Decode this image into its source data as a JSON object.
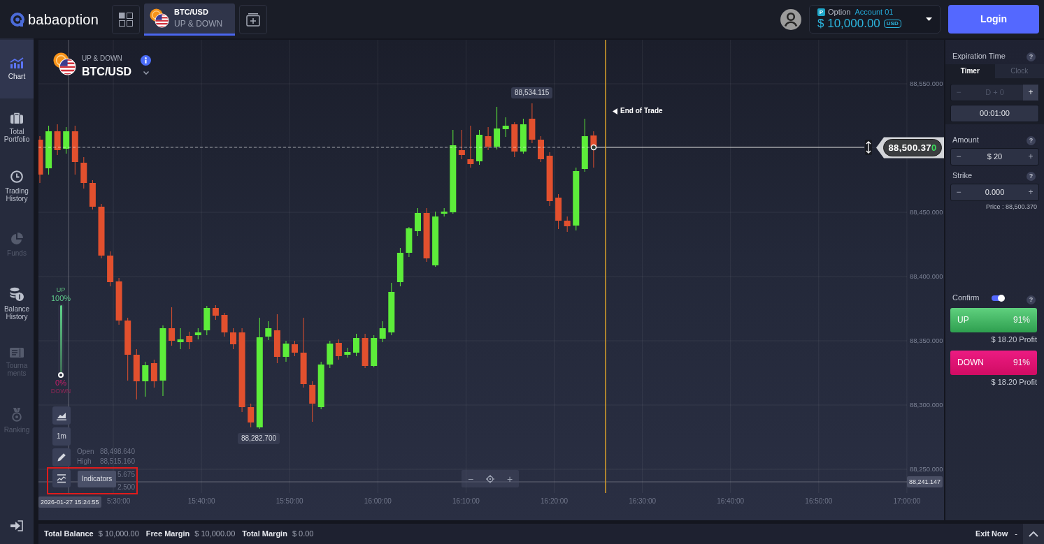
{
  "top_bar": {
    "logo": "babaoption",
    "tabs": [
      {
        "title": "BTC/USD",
        "subtitle": "UP & DOWN",
        "selected": true
      }
    ],
    "account": {
      "badge": "P",
      "type": "Option",
      "name": "Account 01",
      "balance": "$ 10,000.00",
      "currency": "USD"
    },
    "login": "Login"
  },
  "sidebar": {
    "items": [
      {
        "label": "Chart",
        "selected": true,
        "disabled": false
      },
      {
        "label": "Total Portfolio",
        "selected": false,
        "disabled": false
      },
      {
        "label": "Trading History",
        "selected": false,
        "disabled": false
      },
      {
        "label": "Funds",
        "selected": false,
        "disabled": true
      },
      {
        "label": "Balance History",
        "selected": false,
        "disabled": false
      },
      {
        "label": "Tournaments",
        "selected": false,
        "disabled": true
      },
      {
        "label": "Ranking",
        "selected": false,
        "disabled": true
      }
    ]
  },
  "chart": {
    "header": {
      "type": "UP & DOWN",
      "symbol": "BTC/USD"
    },
    "sentiment": {
      "up_label": "UP",
      "up_percent": "100%",
      "level": 1,
      "down_percent": "0%",
      "down_label": "DOWN"
    },
    "tools": [
      {
        "kind": "style"
      },
      {
        "kind": "timeframe",
        "label": "1m"
      },
      {
        "kind": "drawing"
      },
      {
        "kind": "indicators",
        "tooltip": "Indicators",
        "highlighted": true
      }
    ],
    "ohlc": [
      {
        "label": "Open",
        "value": "88,498.640"
      },
      {
        "label": "High",
        "value": "88,515.160"
      },
      {
        "value": "5.675"
      },
      {
        "value": "2.500"
      }
    ],
    "high_marker": "88,534.115",
    "low_marker": "88,282.700",
    "end_of_trade": "End of Trade",
    "current_price": {
      "value": "88,500.37",
      "last_digit": "0"
    },
    "crosshair": {
      "time": "2026-01-27 15:24:55",
      "price": "88,241.147"
    },
    "y_axis": [
      "88,550.000",
      "88,450.000",
      "88,400.000",
      "88,350.000",
      "88,300.000",
      "88,250.000"
    ],
    "x_axis": [
      "5:30:00",
      "15:40:00",
      "15:50:00",
      "16:00:00",
      "16:10:00",
      "16:20:00",
      "16:30:00",
      "16:40:00",
      "16:50:00",
      "17:00:00"
    ],
    "zoom": {
      "out": "−",
      "in": "+"
    }
  },
  "trade_panel": {
    "expiration": {
      "label": "Expiration Time",
      "help": "?",
      "tabs": [
        {
          "label": "Timer",
          "selected": true
        },
        {
          "label": "Clock",
          "selected": false
        }
      ],
      "day": {
        "decrement": "−",
        "value": "D + 0",
        "increment": "+",
        "disabled": true
      },
      "time": "00:01:00"
    },
    "amount": {
      "label": "Amount",
      "help": "?",
      "decrement": "−",
      "value": "$ 20",
      "increment": "+",
      "disabled": false
    },
    "strike": {
      "label": "Strike",
      "help": "?",
      "decrement": "−",
      "value": "0.000",
      "increment": "+",
      "disabled": false,
      "note": "Price : 88,500.370"
    },
    "confirm": {
      "label": "Confirm",
      "on": true,
      "help": "?"
    },
    "actions": [
      {
        "kind": "up",
        "label": "UP",
        "payout": "91%",
        "profit": "$ 18.20 Profit"
      },
      {
        "kind": "down",
        "label": "DOWN",
        "payout": "91%",
        "profit": "$ 18.20 Profit"
      }
    ]
  },
  "status_bar": {
    "items": [
      {
        "label": "Total Balance",
        "value": "$ 10,000.00"
      },
      {
        "label": "Free Margin",
        "value": "$ 10,000.00"
      },
      {
        "label": "Total Margin",
        "value": "$ 0.00"
      }
    ],
    "exit_label": "Exit Now",
    "exit_value": "-"
  }
}
